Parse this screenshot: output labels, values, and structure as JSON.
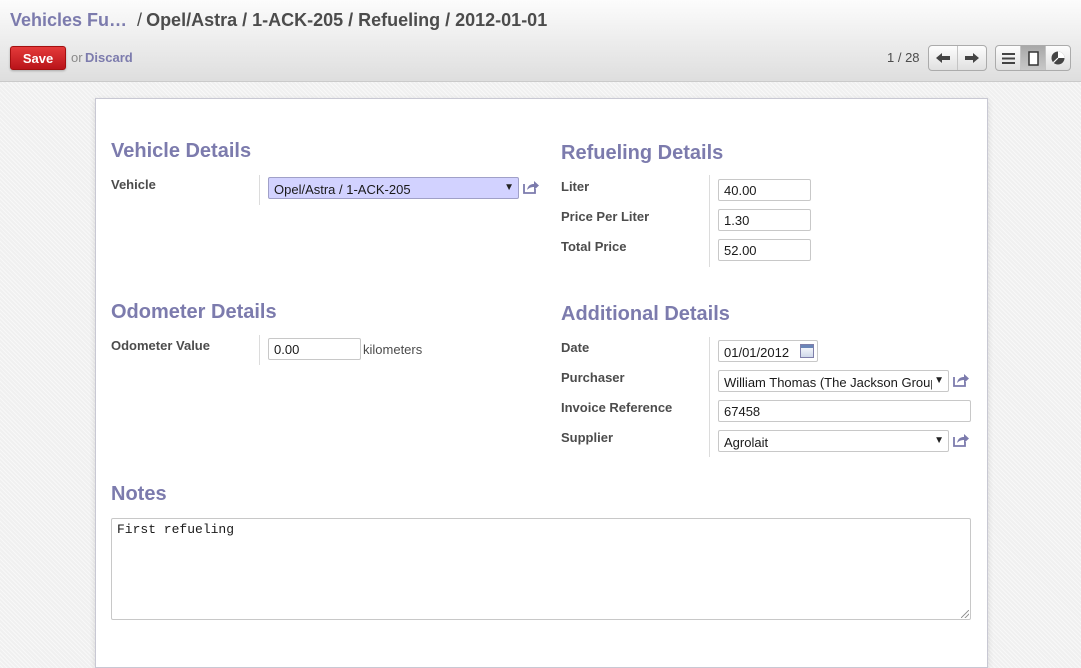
{
  "breadcrumb": {
    "parent": "Vehicles Fu…",
    "separator": "/",
    "current": "Opel/Astra / 1-ACK-205 / Refueling / 2012-01-01"
  },
  "toolbar": {
    "save_label": "Save",
    "or_text": "or",
    "discard_label": "Discard",
    "pager": "1 / 28",
    "save_color": "#c9202a"
  },
  "icons": {
    "prev": "arrow-left-icon",
    "next": "arrow-right-icon",
    "list_view": "list-view-icon",
    "form_view": "form-view-icon",
    "graph_view": "pie-chart-icon",
    "external": "external-link-icon",
    "calendar": "calendar-icon"
  },
  "vehicle_details": {
    "title": "Vehicle Details",
    "vehicle_label": "Vehicle",
    "vehicle_value": "Opel/Astra / 1-ACK-205"
  },
  "refueling_details": {
    "title": "Refueling Details",
    "liter_label": "Liter",
    "liter_value": "40.00",
    "price_label": "Price Per Liter",
    "price_value": "1.30",
    "total_label": "Total Price",
    "total_value": "52.00"
  },
  "odometer_details": {
    "title": "Odometer Details",
    "odometer_label": "Odometer Value",
    "odometer_value": "0.00",
    "unit": "kilometers"
  },
  "additional_details": {
    "title": "Additional Details",
    "date_label": "Date",
    "date_value": "01/01/2012",
    "purchaser_label": "Purchaser",
    "purchaser_value": "William Thomas (The Jackson Group)",
    "invoice_label": "Invoice Reference",
    "invoice_value": "67458",
    "supplier_label": "Supplier",
    "supplier_value": "Agrolait"
  },
  "notes": {
    "title": "Notes",
    "value": "First refueling"
  },
  "colors": {
    "accent": "#7c7bad",
    "highlight_field": "#d2d2ff"
  }
}
